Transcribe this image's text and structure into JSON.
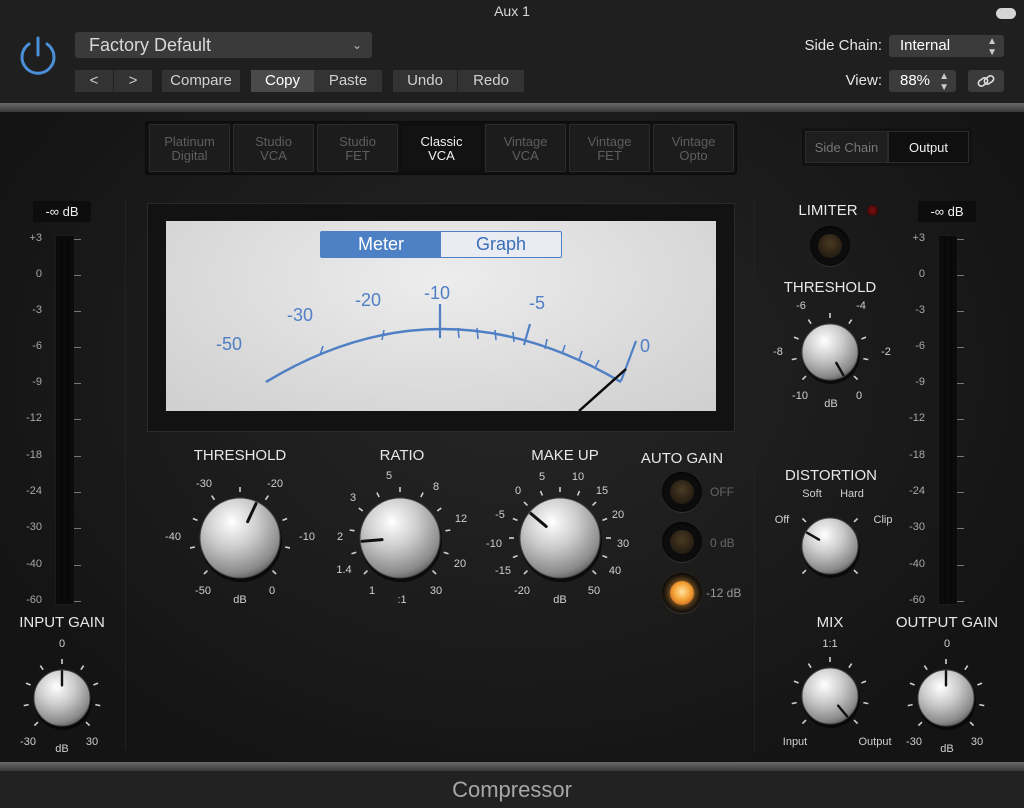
{
  "window": {
    "title": "Aux 1"
  },
  "header": {
    "preset": "Factory Default",
    "prev_label": "<",
    "next_label": ">",
    "compare_label": "Compare",
    "copy_label": "Copy",
    "paste_label": "Paste",
    "undo_label": "Undo",
    "redo_label": "Redo",
    "sidechain_label": "Side Chain:",
    "sidechain_value": "Internal",
    "view_label": "View:",
    "view_value": "88%"
  },
  "models": [
    {
      "line1": "Platinum",
      "line2": "Digital",
      "active": false
    },
    {
      "line1": "Studio",
      "line2": "VCA",
      "active": false
    },
    {
      "line1": "Studio",
      "line2": "FET",
      "active": false
    },
    {
      "line1": "Classic",
      "line2": "VCA",
      "active": true
    },
    {
      "line1": "Vintage",
      "line2": "VCA",
      "active": false
    },
    {
      "line1": "Vintage",
      "line2": "FET",
      "active": false
    },
    {
      "line1": "Vintage",
      "line2": "Opto",
      "active": false
    }
  ],
  "output_tabs": {
    "sidechain": "Side Chain",
    "output": "Output",
    "selected": "Output"
  },
  "meter": {
    "meter_label": "Meter",
    "graph_label": "Graph",
    "selected": "Meter",
    "scale": [
      "-50",
      "-30",
      "-20",
      "-10",
      "-5",
      "0"
    ],
    "accent": "#4e80c6"
  },
  "input_meter": {
    "readout": "-∞ dB",
    "scale": [
      "+3",
      "0",
      "-3",
      "-6",
      "-9",
      "-12",
      "-18",
      "-24",
      "-30",
      "-40",
      "-60"
    ]
  },
  "output_meter": {
    "readout": "-∞ dB",
    "scale": [
      "+3",
      "0",
      "-3",
      "-6",
      "-9",
      "-12",
      "-18",
      "-24",
      "-30",
      "-40",
      "-60"
    ]
  },
  "input_gain": {
    "label": "INPUT GAIN",
    "top": "0",
    "min": "-30",
    "unit": "dB",
    "max": "30"
  },
  "output_gain": {
    "label": "OUTPUT GAIN",
    "top": "0",
    "min": "-30",
    "unit": "dB",
    "max": "30"
  },
  "threshold": {
    "label": "THRESHOLD",
    "ticks": [
      "-30",
      "-20",
      "-40",
      "-10",
      "-50",
      "0"
    ],
    "unit": "dB"
  },
  "ratio": {
    "label": "RATIO",
    "ticks": [
      "5",
      "3",
      "8",
      "12",
      "2",
      "20",
      "1.4",
      "30",
      "1"
    ],
    "unit": ":1"
  },
  "makeup": {
    "label": "MAKE UP",
    "ticks": [
      "5",
      "0",
      "10",
      "15",
      "-5",
      "20",
      "-10",
      "30",
      "-15",
      "40",
      "-20",
      "50"
    ],
    "unit": "dB"
  },
  "auto_gain": {
    "label": "AUTO GAIN",
    "options": [
      "OFF",
      "0 dB",
      "-12 dB"
    ],
    "selected": "-12 dB",
    "led_on_color": "#f7a53a"
  },
  "limiter": {
    "label": "LIMITER",
    "threshold_label": "THRESHOLD",
    "ticks": [
      "-6",
      "-4",
      "-8",
      "-2",
      "-10",
      "0"
    ],
    "unit": "dB",
    "led_color": "#7a1010"
  },
  "distortion": {
    "label": "DISTORTION",
    "soft": "Soft",
    "hard": "Hard",
    "off": "Off",
    "clip": "Clip"
  },
  "mix": {
    "label": "MIX",
    "top": "1:1",
    "left": "Input",
    "right": "Output"
  },
  "footer": {
    "title": "Compressor"
  }
}
